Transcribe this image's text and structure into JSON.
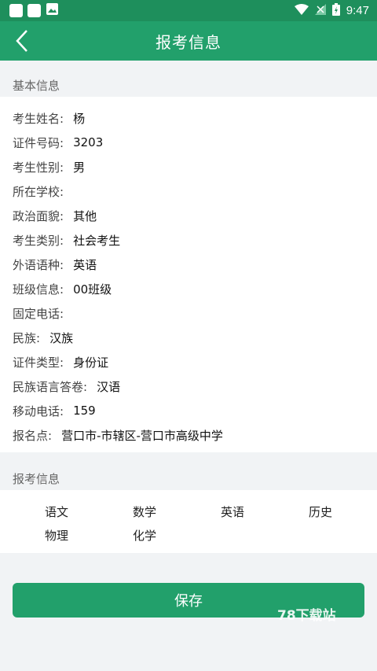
{
  "status_bar": {
    "time": "9:47"
  },
  "header": {
    "title": "报考信息"
  },
  "basic_section": {
    "title": "基本信息"
  },
  "basic_info": [
    {
      "label": "考生姓名:",
      "value": "杨"
    },
    {
      "label": "证件号码:",
      "value": "3203"
    },
    {
      "label": "考生性别:",
      "value": "男"
    },
    {
      "label": "所在学校:",
      "value": ""
    },
    {
      "label": "政治面貌:",
      "value": "其他"
    },
    {
      "label": "考生类别:",
      "value": "社会考生"
    },
    {
      "label": "外语语种:",
      "value": "英语"
    },
    {
      "label": "班级信息:",
      "value": "00班级"
    },
    {
      "label": "固定电话:",
      "value": ""
    },
    {
      "label": "民族:",
      "value": "汉族"
    },
    {
      "label": "证件类型:",
      "value": "身份证"
    },
    {
      "label": "民族语言答卷:",
      "value": "汉语"
    },
    {
      "label": "移动电话:",
      "value": "159"
    },
    {
      "label": "报名点:",
      "value": "营口市-市辖区-营口市高级中学"
    }
  ],
  "exam_section": {
    "title": "报考信息"
  },
  "subjects": [
    "语文",
    "数学",
    "英语",
    "历史",
    "物理",
    "化学"
  ],
  "save_button": {
    "label": "保存"
  },
  "watermark": "78下载站"
}
